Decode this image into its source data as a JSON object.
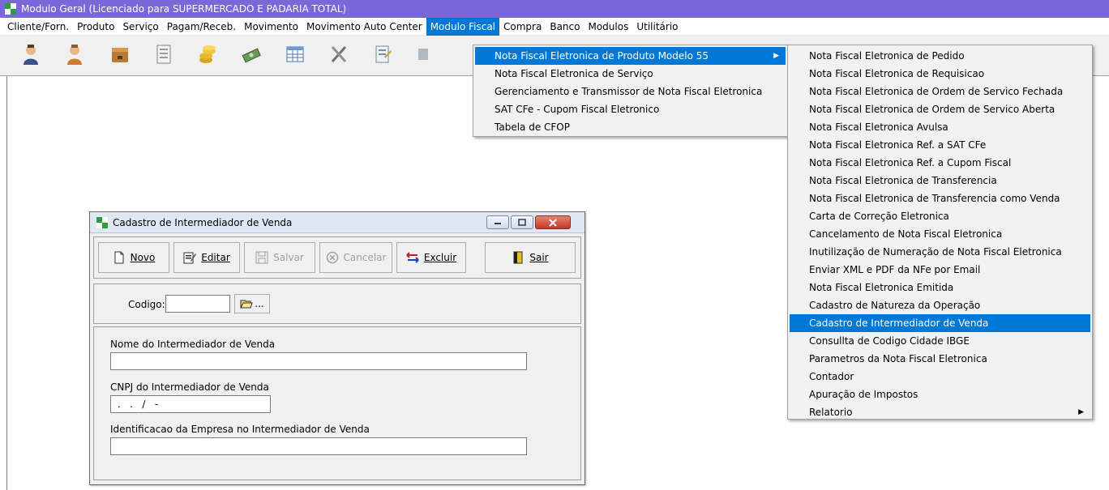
{
  "window": {
    "title": "Modulo Geral (Licenciado para SUPERMERCADO E PADARIA TOTAL)"
  },
  "menubar": {
    "items": [
      "Cliente/Forn.",
      "Produto",
      "Serviço",
      "Pagam/Receb.",
      "Movimento",
      "Movimento Auto Center",
      "Modulo Fiscal",
      "Compra",
      "Banco",
      "Modulos",
      "Utilitário"
    ],
    "active": "Modulo Fiscal"
  },
  "fiscal_menu": {
    "items": [
      "Nota Fiscal Eletronica de Produto Modelo 55",
      "Nota Fiscal Eletronica de Serviço",
      "Gerenciamento e Transmissor de Nota Fiscal Eletronica",
      "SAT CFe - Cupom Fiscal Eletronico",
      "Tabela de CFOP"
    ]
  },
  "nfe_submenu": {
    "items": [
      "Nota Fiscal Eletronica de Pedido",
      "Nota Fiscal Eletronica de Requisicao",
      "Nota Fiscal Eletronica de Ordem de Servico Fechada",
      "Nota Fiscal Eletronica de Ordem de Servico Aberta",
      "Nota Fiscal Eletronica Avulsa",
      "Nota Fiscal Eletronica Ref. a SAT CFe",
      "Nota Fiscal Eletronica Ref. a Cupom Fiscal",
      "Nota Fiscal Eletronica de Transferencia",
      "Nota Fiscal Eletronica de Transferencia como Venda",
      "Carta de Correção Eletronica",
      "Cancelamento de Nota Fiscal Eletronica",
      "Inutilização de Numeração de Nota Fiscal Eletronica",
      "Enviar XML e PDF da NFe por Email",
      "Nota Fiscal Eletronica Emitida",
      "Cadastro de Natureza da Operação",
      "Cadastro de Intermediador de Venda",
      "Consullta de Codigo Cidade IBGE",
      "Parametros da Nota Fiscal Eletronica",
      "Contador",
      "Apuração de Impostos",
      "Relatorio"
    ]
  },
  "dialog": {
    "title": "Cadastro de Intermediador de Venda",
    "buttons": {
      "novo": "Novo",
      "editar": "Editar",
      "salvar": "Salvar",
      "cancelar": "Cancelar",
      "excluir": "Excluir",
      "sair": "Sair"
    },
    "codigo_label": "Codigo:",
    "codigo_value": "",
    "search_button": "...",
    "nome_label": "Nome do Intermediador de Venda",
    "nome_value": "",
    "cnpj_label": "CNPJ do Intermediador de Venda",
    "cnpj_value": " .   .   /   -",
    "identificacao_label": "Identificacao da Empresa no Intermediador de Venda",
    "identificacao_value": ""
  }
}
